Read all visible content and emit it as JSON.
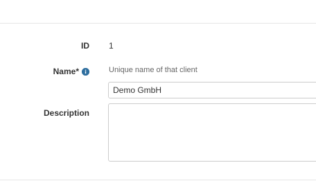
{
  "form": {
    "id": {
      "label": "ID",
      "value": "1"
    },
    "name": {
      "label": "Name*",
      "icon": "info-icon",
      "help": "Unique name of that client",
      "value": "Demo GmbH"
    },
    "description": {
      "label": "Description",
      "value": ""
    }
  },
  "colors": {
    "info_icon": "#2f6f9f",
    "divider": "#e6e6e6",
    "input_border": "#cccccc"
  }
}
